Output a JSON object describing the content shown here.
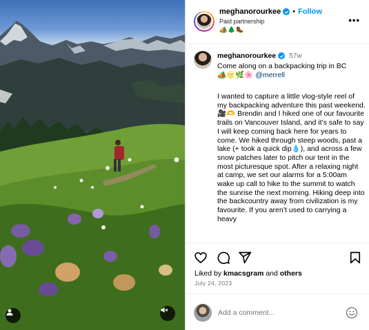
{
  "post_header": {
    "username": "meghanorourkee",
    "separator": "•",
    "follow_label": "Follow",
    "subtitle": "Paid partnership",
    "emoji_line": "🏕️🌲🥾",
    "more_label": "•••"
  },
  "caption": {
    "username": "meghanorourkee",
    "time_ago": "57w",
    "title_text": "Come along on a backpacking trip in BC",
    "title_emoji": "🏕️🌝🌿🌸",
    "mention": "@merrell",
    "body": "I wanted to capture a little vlog-style reel of my backpacking adventure this past weekend. 🎥🫶 Brendin and I hiked one of our favourite trails on Vancouver Island, and it’s safe to say I will keep coming back here for years to come. We hiked through steep woods, past a lake (+ took a quick dip💧), and across a few snow patches later to pitch our tent in the most picturesque spot. After a relaxing night at camp, we set our alarms for a 5:00am wake up call to hike to the summit to watch the sunrise the next morning. Hiking deep into the backcountry away from civilization is my favourite. If you aren’t used to carrying a heavy"
  },
  "engagement": {
    "liked_prefix": "Liked by ",
    "liked_user": "kmacsgram",
    "liked_and": " and ",
    "liked_others": "others",
    "date": "July 24, 2023"
  },
  "comment_box": {
    "placeholder": "Add a comment..."
  },
  "icons": {
    "like": "heart-icon",
    "comment": "comment-icon",
    "share": "share-icon",
    "save": "bookmark-icon",
    "emoji": "smiley-icon",
    "media_user": "user-tag-icon",
    "media_mute": "muted-speaker-icon",
    "verified": "verified-badge-icon"
  },
  "colors": {
    "accent": "#0095f6",
    "mention": "#00376b",
    "muted_text": "#737373",
    "divider": "#efefef"
  }
}
